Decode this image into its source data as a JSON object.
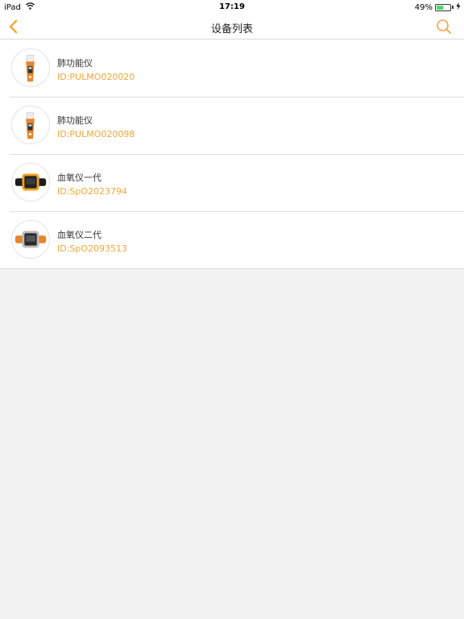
{
  "status": {
    "device": "iPad",
    "time": "17:19",
    "battery_text": "49%",
    "battery_level": 0.49
  },
  "nav": {
    "title": "设备列表",
    "accent_color": "#f0a63a"
  },
  "devices": [
    {
      "name": "肺功能仪",
      "id": "ID:PULMO020020",
      "icon": "spirometer-image"
    },
    {
      "name": "肺功能仪",
      "id": "ID:PULMO020098",
      "icon": "spirometer-image"
    },
    {
      "name": "血氧仪一代",
      "id": "ID:SpO2023794",
      "icon": "oximeter-watch-black-image"
    },
    {
      "name": "血氧仪二代",
      "id": "ID:SpO2093513",
      "icon": "oximeter-watch-orange-image"
    }
  ]
}
